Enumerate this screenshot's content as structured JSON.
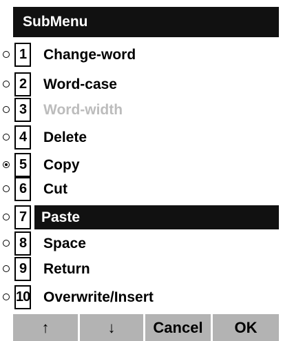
{
  "title": "SubMenu",
  "items": [
    {
      "number": "1",
      "label": "Change-word",
      "state": "normal"
    },
    {
      "number": "2",
      "label": "Word-case",
      "state": "normal"
    },
    {
      "number": "3",
      "label": "Word-width",
      "state": "disabled"
    },
    {
      "number": "4",
      "label": "Delete",
      "state": "normal"
    },
    {
      "number": "5",
      "label": "Copy",
      "state": "checked"
    },
    {
      "number": "6",
      "label": "Cut",
      "state": "normal"
    },
    {
      "number": "7",
      "label": "Paste",
      "state": "highlighted"
    },
    {
      "number": "8",
      "label": "Space",
      "state": "normal"
    },
    {
      "number": "9",
      "label": "Return",
      "state": "normal"
    },
    {
      "number": "10",
      "label": "Overwrite/Insert",
      "state": "normal"
    }
  ],
  "softkeys": {
    "up": "↑",
    "down": "↓",
    "cancel": "Cancel",
    "ok": "OK"
  },
  "colors": {
    "highlight": "#111111",
    "disabled_text": "#bcbcbc",
    "softkey_bg": "#b3b3b3"
  }
}
